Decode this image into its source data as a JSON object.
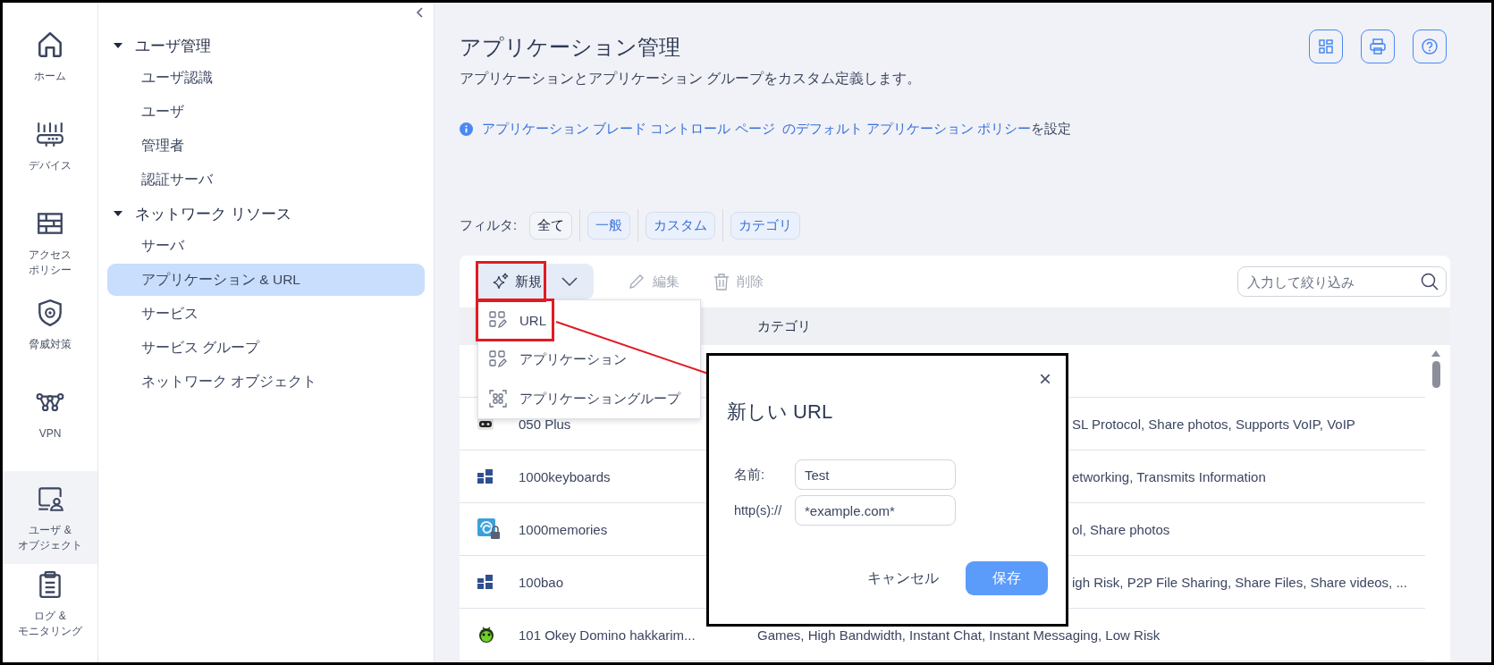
{
  "rail": {
    "items": [
      {
        "lines": [
          "ホーム"
        ],
        "kind": "home",
        "selected": false
      },
      {
        "lines": [
          "デバイス"
        ],
        "kind": "router",
        "selected": false
      },
      {
        "lines": [
          "アクセス",
          "ポリシー"
        ],
        "kind": "firewall",
        "selected": false
      },
      {
        "lines": [
          "脅威対策"
        ],
        "kind": "shield",
        "selected": false
      },
      {
        "lines": [
          "VPN"
        ],
        "kind": "vpn",
        "selected": false
      },
      {
        "lines": [
          "ユーザ &",
          "オブジェクト"
        ],
        "kind": "user",
        "selected": true
      },
      {
        "lines": [
          "ログ &",
          "モニタリング"
        ],
        "kind": "clipboard",
        "selected": false
      }
    ]
  },
  "sidebar": {
    "groups": [
      {
        "title": "ユーザ管理",
        "expanded": true,
        "items": [
          {
            "label": "ユーザ認識",
            "selected": false
          },
          {
            "label": "ユーザ",
            "selected": false
          },
          {
            "label": "管理者",
            "selected": false
          },
          {
            "label": "認証サーバ",
            "selected": false
          }
        ]
      },
      {
        "title": "ネットワーク リソース",
        "expanded": true,
        "items": [
          {
            "label": "サーバ",
            "selected": false
          },
          {
            "label": "アプリケーション & URL",
            "selected": true
          },
          {
            "label": "サービス",
            "selected": false
          },
          {
            "label": "サービス グループ",
            "selected": false
          },
          {
            "label": "ネットワーク オブジェクト",
            "selected": false
          }
        ]
      }
    ]
  },
  "header": {
    "title": "アプリケーション管理",
    "subtitle": "アプリケーションとアプリケーション グループをカスタム定義します。"
  },
  "info": {
    "link": "アプリケーション ブレード コントロール ページ",
    "link_2": "のデフォルト アプリケーション ポリシー",
    "text": "を設定"
  },
  "filters": {
    "label": "フィルタ:",
    "chips": [
      {
        "label": "全て",
        "selected": true
      },
      {
        "label": "一般",
        "selected": false
      },
      {
        "label": "カスタム",
        "selected": false
      },
      {
        "label": "カテゴリ",
        "selected": false
      }
    ]
  },
  "toolbar": {
    "new_button": {
      "label": "新規",
      "annotated": true
    },
    "edit_button": {
      "label": "編集",
      "disabled": true
    },
    "delete_button": {
      "label": "削除",
      "disabled": true
    },
    "search": {
      "placeholder": "入力して絞り込み"
    }
  },
  "new_menu": {
    "items": [
      {
        "label": "URL",
        "kind": "edit",
        "annotated": true
      },
      {
        "label": "アプリケーション",
        "kind": "edit",
        "annotated": false
      },
      {
        "label": "アプリケーショングループ",
        "kind": "group",
        "annotated": false
      }
    ]
  },
  "table": {
    "category_header": "カテゴリ",
    "rows": [
      {
        "name": "050 Plus",
        "kind": "gamepad",
        "obscured": true,
        "category": "SL Protocol, Share photos, Supports VoIP, VoIP"
      },
      {
        "name": "1000keyboards",
        "kind": "tiles",
        "obscured": true,
        "category": "etworking, Transmits Information"
      },
      {
        "name": "1000memories",
        "kind": "swirl",
        "obscured": true,
        "category": "ol, Share photos"
      },
      {
        "name": "100bao",
        "kind": "tiles",
        "obscured": true,
        "category": "igh Risk, P2P File Sharing, Share Files, Share videos, ..."
      },
      {
        "name": "101 Okey Domino hakkarim...",
        "kind": "bug",
        "obscured": false,
        "category": "Games, High Bandwidth, Instant Chat, Instant Messaging, Low Risk"
      }
    ]
  },
  "dialog": {
    "close": "×",
    "title": "新しい URL",
    "fields": [
      {
        "label": "名前:",
        "value": "Test"
      },
      {
        "label": "http(s)://",
        "value": "*example.com*"
      }
    ],
    "cancel": "キャンセル",
    "save": "保存"
  }
}
